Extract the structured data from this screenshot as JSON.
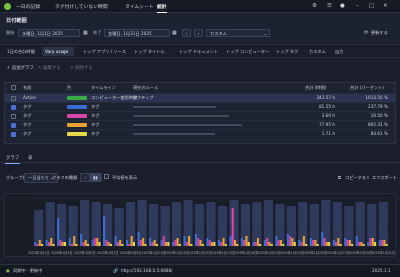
{
  "titlebar": {
    "tabs": [
      "一日の記録",
      "タグ付けしていない時間",
      "タイムシート",
      "統計"
    ],
    "active_tab": "統計",
    "icons": [
      "extensions-icon",
      "settings-icon",
      "account-icon",
      "minimize-icon",
      "maximize-icon",
      "close-icon"
    ]
  },
  "header": {
    "title": "日付範囲",
    "start_label": "開始",
    "start_value": "水曜日, 1月1日 2025",
    "end_label": "終了",
    "end_value": "金曜日, 1月31日 2025",
    "preset_value": "カスタム",
    "refresh_label": "更新する"
  },
  "view_tabs": [
    {
      "label": "1日の合計時間"
    },
    {
      "label": "Vary usage",
      "active": true
    },
    {
      "label": "トップ アプリ / ソース"
    },
    {
      "label": "トップ タイトル"
    },
    {
      "label": "トップ ドキュメント"
    },
    {
      "label": "トップ コンピューター"
    },
    {
      "label": "トップ タグ"
    },
    {
      "label": "カスタム"
    },
    {
      "label": "出力"
    }
  ],
  "toolbar": {
    "add_label": "追加グラフ",
    "edit_label": "編集する",
    "delete_label": "削除する"
  },
  "grid": {
    "columns": [
      "名前",
      "色",
      "タイムライン",
      "現在のルール",
      "合計 (時間)",
      "合計 (パーセント)"
    ],
    "rows": [
      {
        "name": "Active",
        "color": "#3aa845",
        "timeline": "コンピューター使用時間",
        "rule": "アクティブ",
        "hours": "343.57 h",
        "percent": "1013.56 %",
        "checked": false,
        "selected": true
      },
      {
        "name": "タグ",
        "color": "#3b6fd8",
        "timeline": "タグ",
        "rule": "",
        "hours": "81.55 h",
        "percent": "237.79 %",
        "checked": true,
        "selected": false
      },
      {
        "name": "タグ",
        "color": "#d845a8",
        "timeline": "タグ",
        "rule": "",
        "hours": "3.60 h",
        "percent": "10.50 %",
        "checked": false,
        "selected": false
      },
      {
        "name": "タグ",
        "color": "#e8a030",
        "timeline": "タグ",
        "rule": "",
        "hours": "77.95 h",
        "percent": "865.31 %",
        "checked": true,
        "selected": false
      },
      {
        "name": "タグ",
        "color": "#e8d84a",
        "timeline": "タグ",
        "rule": "",
        "hours": "1.71 h",
        "percent": "84.61 %",
        "checked": true,
        "selected": false
      }
    ]
  },
  "bottom_tabs": [
    "グラフ",
    "表"
  ],
  "graph_controls": {
    "group_label": "グループ化",
    "group_value": "一日当たり",
    "type_label": "グラフの種類",
    "average_label": "平均値を表示",
    "copy_label": "コピーする",
    "export_label": "エクスポート"
  },
  "chart_data": {
    "type": "bar",
    "categories": [
      "2025年1月1日",
      "2025年1月2日",
      "2025年1月3日",
      "2025年1月4日",
      "2025年1月5日",
      "2025年1月6日",
      "2025年1月7日",
      "2025年1月8日",
      "2025年1月9日",
      "2025年1月10日",
      "2025年1月11日",
      "2025年1月12日",
      "2025年1月13日",
      "2025年1月14日",
      "2025年1月15日",
      "2025年1月16日",
      "2025年1月17日",
      "2025年1月18日",
      "2025年1月19日",
      "2025年1月20日",
      "2025年1月21日",
      "2025年1月22日",
      "2025年1月23日",
      "2025年1月24日",
      "2025年1月25日",
      "2025年1月26日",
      "2025年1月27日",
      "2025年1月28日",
      "2025年1月29日",
      "2025年1月30日",
      "2025年1月31日"
    ],
    "tick_labels": [
      "2025年1月1日",
      "2025年1月3日",
      "2025年1月5日",
      "2025年1月7日",
      "2025年1月9日",
      "2025年1月11日",
      "2025年1月13日",
      "2025年1月15日",
      "2025年1月17日",
      "2025年1月19日",
      "2025年1月21日",
      "2025年1月23日",
      "2025年1月25日",
      "2025年1月27日",
      "2025年1月29日",
      "2025年1月31日"
    ],
    "ylim": [
      0,
      24
    ],
    "series": [
      {
        "color": "#2f3a5c",
        "values": [
          18,
          22,
          21,
          20,
          23,
          22,
          21,
          19,
          22,
          23,
          21,
          20,
          22,
          23,
          21,
          22,
          20,
          23,
          21,
          22,
          23,
          21,
          20,
          22,
          21,
          23,
          22,
          20,
          22,
          21,
          22
        ]
      },
      {
        "color": "#3b6fd8",
        "values": [
          2,
          3,
          14,
          4,
          6,
          3,
          15,
          5,
          3,
          7,
          4,
          3,
          2,
          5,
          6,
          4,
          3,
          5,
          4,
          2,
          3,
          5,
          6,
          3,
          4,
          7,
          3,
          4,
          5,
          2,
          3
        ]
      },
      {
        "color": "#d845a8",
        "values": [
          1,
          2,
          3,
          1,
          2,
          4,
          3,
          2,
          1,
          3,
          2,
          5,
          3,
          2,
          4,
          3,
          2,
          19,
          3,
          2,
          4,
          3,
          5,
          2,
          3,
          4,
          2,
          3,
          2,
          4,
          3
        ]
      },
      {
        "color": "#e8a030",
        "values": [
          3,
          4,
          2,
          5,
          3,
          4,
          2,
          3,
          5,
          4,
          3,
          2,
          4,
          5,
          3,
          2,
          4,
          3,
          5,
          4,
          2,
          3,
          4,
          5,
          3,
          2,
          4,
          3,
          2,
          4,
          3
        ]
      },
      {
        "color": "#e8d84a",
        "values": [
          1,
          1,
          2,
          1,
          1,
          2,
          1,
          1,
          2,
          1,
          1,
          2,
          1,
          1,
          1,
          2,
          1,
          1,
          2,
          1,
          1,
          1,
          2,
          1,
          1,
          2,
          1,
          1,
          1,
          2,
          1
        ]
      }
    ],
    "grid": true
  },
  "status": {
    "left_label": "同期中 - 更新中",
    "url": "http://192.168.0.5:8888/",
    "right_text": "2025.1.1"
  }
}
